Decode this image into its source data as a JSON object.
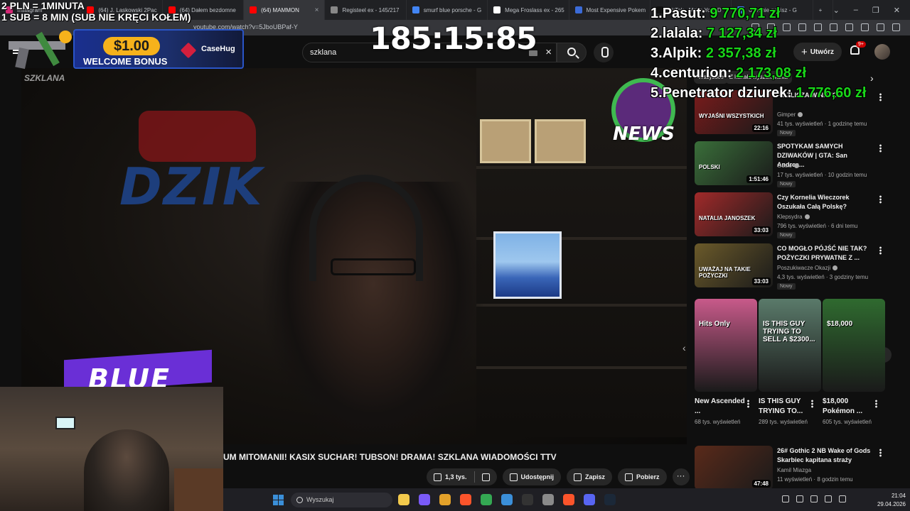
{
  "browser": {
    "tabs": [
      {
        "label": "Instagram",
        "active": false,
        "color": "#d62976"
      },
      {
        "label": "(64) J. Laskowski 2Pac",
        "active": false,
        "color": "#ff0000"
      },
      {
        "label": "(64) Dałem bezdomne",
        "active": false,
        "color": "#ff0000"
      },
      {
        "label": "(64) MAMMON",
        "active": true,
        "color": "#ff0000"
      },
      {
        "label": "Registeel ex - 145/217",
        "active": false,
        "color": "#888888"
      },
      {
        "label": "smurf blue porsche - G",
        "active": false,
        "color": "#4285f4"
      },
      {
        "label": "Mega Froslass ex - 265",
        "active": false,
        "color": "#ffffff"
      },
      {
        "label": "Most Expensive Pokem",
        "active": false,
        "color": "#3b6bd8"
      },
      {
        "label": "TikTok - Make Your D",
        "active": false,
        "color": "#111111"
      },
      {
        "label": "o branie ganisz - G",
        "active": false,
        "color": "#4285f4"
      }
    ],
    "new_tab": "+",
    "window_controls": [
      "⌄",
      "–",
      "❐",
      "✕"
    ],
    "url": "youtube.com/watch?v=5JboUBPaf-Y"
  },
  "masthead": {
    "search_value": "szklana",
    "create_label": "Utwórz",
    "notifications_badge": "9+"
  },
  "overlay": {
    "promo_line1": "2 PLN = 1MINUTA",
    "promo_line2": "1 SUB = 8 MIN (SUB NIE KRĘCI KOŁEM)",
    "casehug_amount": "$1.00",
    "casehug_bonus": "WELCOME BONUS",
    "casehug_brand": "CaseHug",
    "szklana_tag": "SZKLANA",
    "timer": "185:15:85",
    "sign_text": "DZIK",
    "knews_text": "NEWS",
    "banner_text": "BLUE"
  },
  "leaderboard": [
    {
      "rank": "1.",
      "name": "Pasut:",
      "amount": "9 770,71 zł"
    },
    {
      "rank": "2.",
      "name": "lalala:",
      "amount": "7 127,34 zł"
    },
    {
      "rank": "3.",
      "name": "Alpik:",
      "amount": "2 357,38 zł"
    },
    {
      "rank": "4.",
      "name": "centurion:",
      "amount": "2 173,08 zł"
    },
    {
      "rank": "5.",
      "name": "Penetrator dziurek:",
      "amount": "1 776,60 zł"
    }
  ],
  "sidebar": {
    "chips": [
      "Wszystkie",
      "Z kanału wyszukiwania"
    ],
    "recommendations": [
      {
        "title": "ROZLICZA WINNYCH!",
        "channel": "Gimper",
        "meta": "41 tys. wyświetleń · 1 godzinę temu",
        "badge": "Nowy",
        "duration": "22:16",
        "thumb_text": "WYJAŚNI WSZYSTKICH",
        "thumb_color": "#7a1b1b"
      },
      {
        "title": "SPOTYKAM SAMYCH DZIWAKÓW | GTA: San Andrea...",
        "channel": "Gucio",
        "meta": "17 tys. wyświetleń · 10 godzin temu",
        "badge": "Nowy",
        "duration": "1:51:46",
        "thumb_text": "POLSKI",
        "thumb_color": "#3a6f3a"
      },
      {
        "title": "Czy Kornelia Wieczorek Oszukała Całą Polskę?",
        "channel": "Klepsydra",
        "meta": "796 tys. wyświetleń · 6 dni temu",
        "badge": "Nowy",
        "duration": "33:03",
        "thumb_text": "NATALIA JANOSZEK",
        "thumb_color": "#a12a2a"
      },
      {
        "title": "CO MOGŁO PÓJŚĆ NIE TAK? POŻYCZKI PRYWATNE Z ...",
        "channel": "Poszukiwacze Okazji",
        "meta": "4,3 tys. wyświetleń · 3 godziny temu",
        "badge": "Nowy",
        "duration": "33:03",
        "thumb_text": "UWAŻAJ NA TAKIE POŻYCZKI",
        "thumb_color": "#6b5a2a"
      }
    ],
    "shorts": [
      {
        "title": "New Ascended ...",
        "views": "68 tys. wyświetleń",
        "thumb_text": "Hits Only",
        "thumb_color": "#c85a8a"
      },
      {
        "title": "IS THIS GUY TRYING TO...",
        "views": "289 tys. wyświetleń",
        "thumb_text": "IS THIS GUY TRYING TO SELL A $2300...",
        "thumb_color": "#5a7a6a"
      },
      {
        "title": "$18,000 Pokémon ...",
        "views": "605 tys. wyświetleń",
        "thumb_text": "$18,000",
        "thumb_color": "#2f6a2f"
      }
    ],
    "bottom_rec": {
      "title": "26# Gothic 2 NB Wake of Gods Skarbiec kapitana straży",
      "channel": "Kamil Miazga",
      "meta": "11 wyświetleń · 8 godzin temu",
      "duration": "47:48",
      "thumb_color": "#5a2a1a"
    }
  },
  "video": {
    "title": "UM MITOMANII! KASIX SUCHAR! TUBSON! DRAMA! SZKLANA WIADOMOŚCI TTV",
    "like_count": "1,3 tys.",
    "share_label": "Udostępnij",
    "save_label": "Zapisz",
    "download_label": "Pobierz",
    "more_label": "···"
  },
  "taskbar": {
    "search_placeholder": "Wyszukaj",
    "time": "21:04",
    "date": "29.04.2026",
    "apps": [
      {
        "name": "file-explorer-icon",
        "color": "#f2c94c"
      },
      {
        "name": "copilot-icon",
        "color": "#7a5af8"
      },
      {
        "name": "widgets-icon",
        "color": "#e3a12a"
      },
      {
        "name": "brave-icon",
        "color": "#fb542b"
      },
      {
        "name": "chrome-icon",
        "color": "#34a853"
      },
      {
        "name": "store-icon",
        "color": "#3b8fd9"
      },
      {
        "name": "obs-icon",
        "color": "#333333"
      },
      {
        "name": "settings-icon",
        "color": "#8a8a8a"
      },
      {
        "name": "brave-active-icon",
        "color": "#fb542b"
      },
      {
        "name": "discord-icon",
        "color": "#5865f2"
      },
      {
        "name": "steam-icon",
        "color": "#1b2838"
      }
    ]
  }
}
